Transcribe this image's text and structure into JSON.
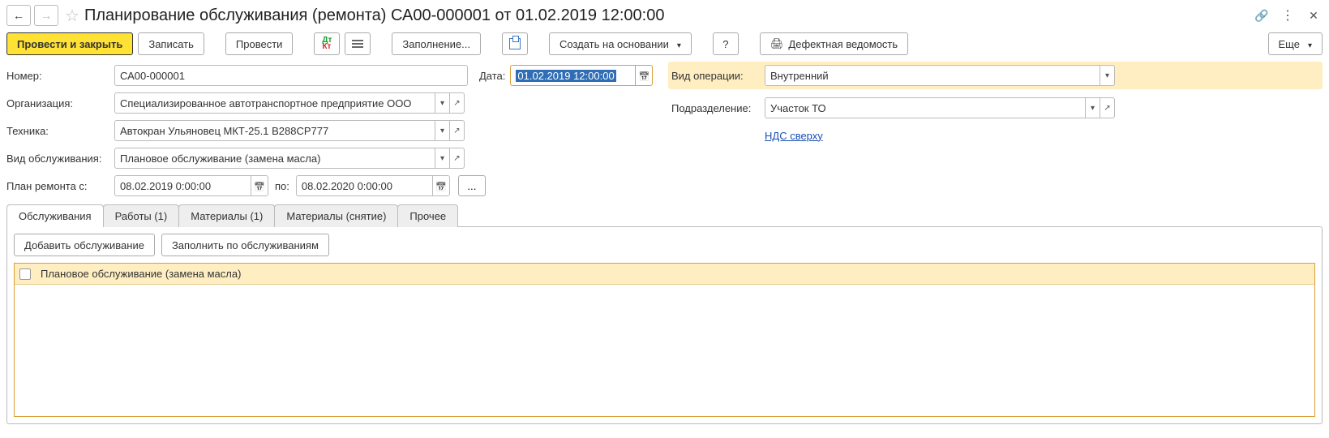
{
  "title": "Планирование обслуживания (ремонта) СА00-000001 от 01.02.2019 12:00:00",
  "toolbar": {
    "post_and_close": "Провести и закрыть",
    "save": "Записать",
    "post": "Провести",
    "fill": "Заполнение...",
    "create_based": "Создать на основании",
    "help": "?",
    "defect_report": "Дефектная ведомость",
    "more": "Еще"
  },
  "labels": {
    "number": "Номер:",
    "date": "Дата:",
    "org": "Организация:",
    "tech": "Техника:",
    "service_type": "Вид обслуживания:",
    "plan_from": "План ремонта с:",
    "plan_to": "по:",
    "op_type": "Вид операции:",
    "division": "Подразделение:"
  },
  "fields": {
    "number": "СА00-000001",
    "date": "01.02.2019 12:00:00",
    "org": "Специализированное автотранспортное предприятие ООО",
    "tech": "Автокран Ульяновец МКТ-25.1 В288СР777",
    "service_type": "Плановое обслуживание (замена масла)",
    "plan_from": "08.02.2019  0:00:00",
    "plan_to": "08.02.2020  0:00:00",
    "op_type": "Внутренний",
    "division": "Участок ТО"
  },
  "link_vat": "НДС сверху",
  "tabs": {
    "items": [
      "Обслуживания",
      "Работы (1)",
      "Материалы (1)",
      "Материалы (снятие)",
      "Прочее"
    ],
    "active_index": 0
  },
  "sub_toolbar": {
    "add": "Добавить обслуживание",
    "fill_by": "Заполнить по обслуживаниям"
  },
  "grid_rows": [
    {
      "checked": false,
      "text": "Плановое обслуживание (замена масла)"
    }
  ]
}
